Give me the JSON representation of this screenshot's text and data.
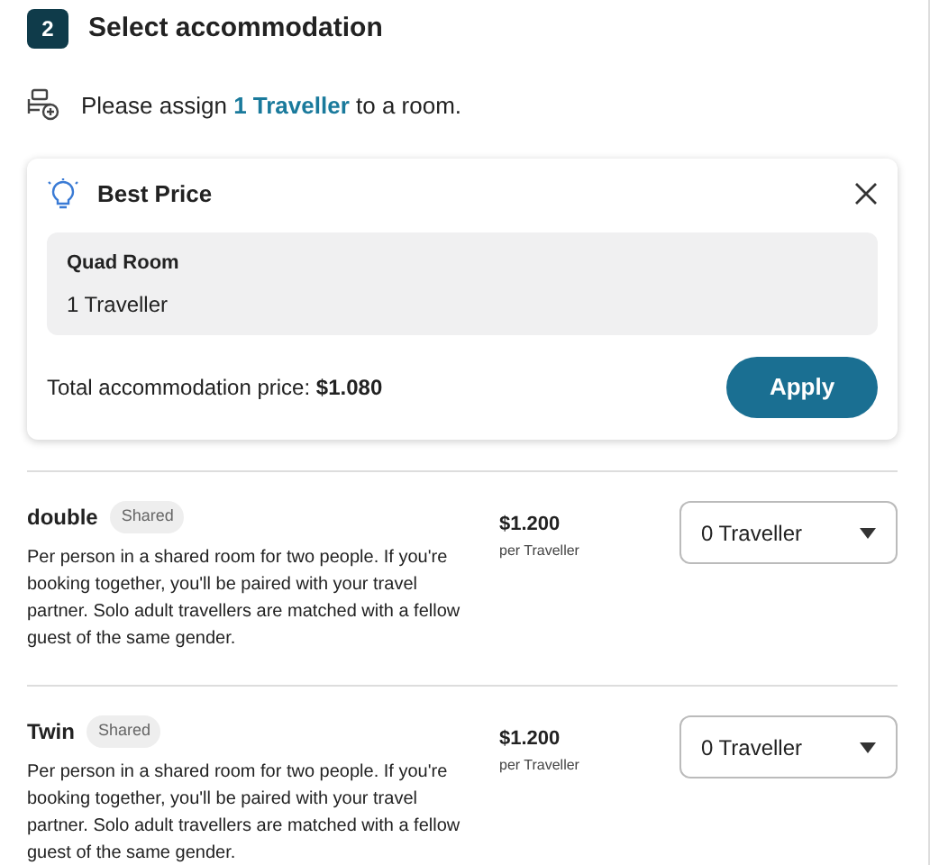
{
  "step": {
    "number": "2",
    "title": "Select accommodation"
  },
  "instruction": "Please assign **1 Traveller** to a room.",
  "best_price": {
    "title": "Best Price",
    "room_name": "Quad Room",
    "room_travellers": "1 Traveller",
    "total_label": "Total accommodation price:",
    "total_value": "$1.080",
    "apply_label": "Apply"
  },
  "rooms": [
    {
      "name": "double",
      "tag": "Shared",
      "description": "Per person in a shared room for two people. If you're booking together, you'll be paired with your travel partner. Solo adult travellers are matched with a fellow guest of the same gender.",
      "price": "$1.200",
      "price_unit": "per Traveller",
      "selection": "0 Traveller"
    },
    {
      "name": "Twin",
      "tag": "Shared",
      "description": "Per person in a shared room for two people. If you're booking together, you'll be paired with your travel partner. Solo adult travellers are matched with a fellow guest of the same gender.",
      "price": "$1.200",
      "price_unit": "per Traveller",
      "selection": "0 Traveller"
    }
  ]
}
